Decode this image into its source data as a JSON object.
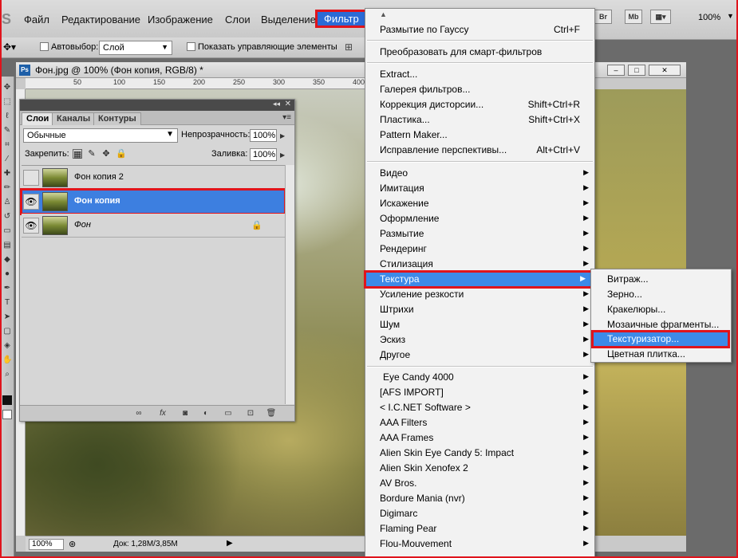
{
  "menubar": {
    "logo": "S",
    "items": [
      "Файл",
      "Редактирование",
      "Изображение",
      "Слои",
      "Выделение",
      "Фильтр"
    ],
    "right": {
      "br": "Br",
      "mb": "Mb",
      "zoom": "100%"
    }
  },
  "optbar": {
    "autoselect_label": "Автовыбор:",
    "autoselect_value": "Слой",
    "show_controls_label": "Показать управляющие элементы"
  },
  "document": {
    "title": "Фон.jpg @ 100% (Фон копия, RGB/8) *",
    "ps_badge": "Ps",
    "ruler_marks": [
      "50",
      "100",
      "150",
      "200",
      "250",
      "300",
      "350",
      "400"
    ],
    "status_zoom": "100%",
    "status_info": "Док: 1,28M/3,85M"
  },
  "layers_panel": {
    "tabs": [
      "Слои",
      "Каналы",
      "Контуры"
    ],
    "blend_mode": "Обычные",
    "opacity_label": "Непрозрачность:",
    "opacity_value": "100%",
    "lock_label": "Закрепить:",
    "fill_label": "Заливка:",
    "fill_value": "100%",
    "layers": [
      {
        "name": "Фон копия 2",
        "visible": false,
        "selected": false
      },
      {
        "name": "Фон копия",
        "visible": true,
        "selected": true
      },
      {
        "name": "Фон",
        "visible": true,
        "selected": false,
        "locked": true
      }
    ]
  },
  "filter_menu": {
    "group1": [
      {
        "label": "Размытие по Гауссу",
        "shortcut": "Ctrl+F"
      }
    ],
    "group2": [
      {
        "label": "Преобразовать для смарт-фильтров"
      }
    ],
    "group3": [
      {
        "label": "Extract..."
      },
      {
        "label": "Галерея фильтров..."
      },
      {
        "label": "Коррекция дисторсии...",
        "shortcut": "Shift+Ctrl+R"
      },
      {
        "label": "Пластика...",
        "shortcut": "Shift+Ctrl+X"
      },
      {
        "label": "Pattern Maker..."
      },
      {
        "label": "Исправление перспективы...",
        "shortcut": "Alt+Ctrl+V"
      }
    ],
    "group4": [
      "Видео",
      "Имитация",
      "Искажение",
      "Оформление",
      "Размытие",
      "Рендеринг",
      "Стилизация",
      "Текстура",
      "Усиление резкости",
      "Штрихи",
      "Шум",
      "Эскиз",
      "Другое"
    ],
    "group5": [
      "Eye Candy 4000",
      "[AFS IMPORT]",
      "< I.C.NET Software >",
      "AAA Filters",
      "AAA Frames",
      "Alien Skin Eye Candy 5: Impact",
      "Alien Skin Xenofex 2",
      "AV Bros.",
      "Bordure Mania (nvr)",
      "Digimarc",
      "Flaming Pear",
      "Flou-Mouvement"
    ],
    "highlighted": "Текстура"
  },
  "texture_submenu": {
    "items": [
      "Витраж...",
      "Зерно...",
      "Кракелюры...",
      "Мозаичные фрагменты...",
      "Текстуризатор...",
      "Цветная плитка..."
    ],
    "highlighted": "Текстуризатор..."
  },
  "colors": {
    "highlight": "#3d8ae8",
    "annotation_red": "#e0141c",
    "menu_bg": "#f2f2f2"
  }
}
